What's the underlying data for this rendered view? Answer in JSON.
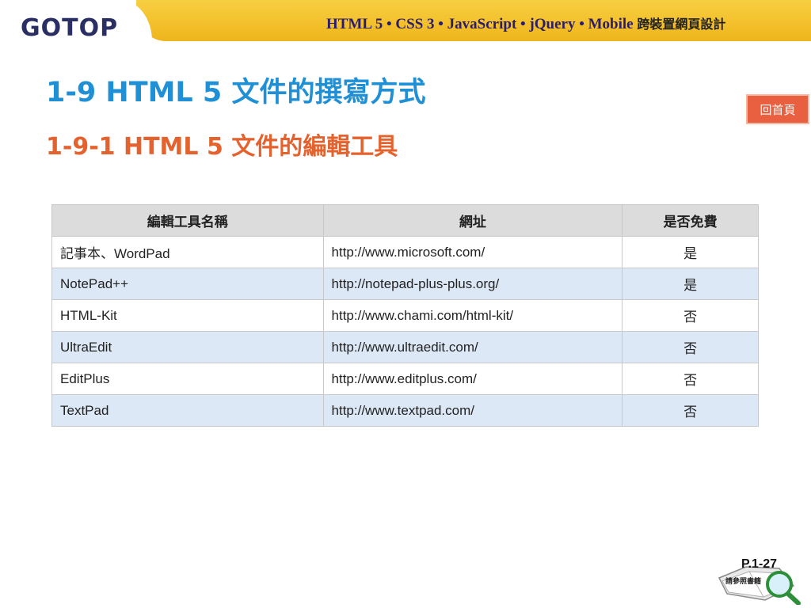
{
  "header": {
    "logo": "GOTOP",
    "banner_latin": "HTML 5 • CSS 3 • JavaScript • jQuery • Mobile",
    "banner_cjk": "跨裝置網頁設計"
  },
  "title": "1-9  HTML 5 文件的撰寫方式",
  "subtitle": "1-9-1 HTML 5 文件的編輯工具",
  "home_button": "回首頁",
  "table": {
    "headers": [
      "編輯工具名稱",
      "網址",
      "是否免費"
    ],
    "rows": [
      [
        "記事本、WordPad",
        "http://www.microsoft.com/",
        "是"
      ],
      [
        "NotePad++",
        "http://notepad-plus-plus.org/",
        "是"
      ],
      [
        "HTML-Kit",
        "http://www.chami.com/html-kit/",
        "否"
      ],
      [
        "UltraEdit",
        "http://www.ultraedit.com/",
        "否"
      ],
      [
        "EditPlus",
        "http://www.editplus.com/",
        "否"
      ],
      [
        "TextPad",
        "http://www.textpad.com/",
        "否"
      ]
    ]
  },
  "page": {
    "number": "P.1-27",
    "ref_text": "請參照書籍"
  },
  "colors": {
    "title": "#1f8fd6",
    "subtitle": "#e4622e",
    "header_band": "#f3c12c",
    "home_button": "#e8603f",
    "row_alt": "#dde8f6"
  }
}
